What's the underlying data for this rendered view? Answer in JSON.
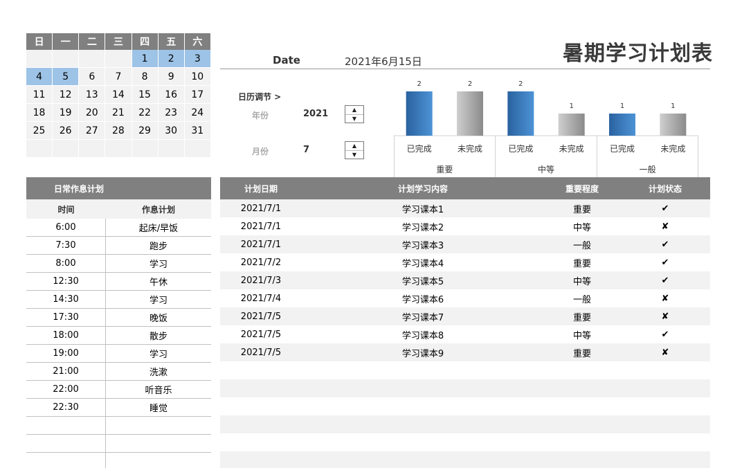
{
  "title": "暑期学习计划表",
  "date": {
    "label": "Date",
    "value": "2021年6月15日"
  },
  "calendar": {
    "weekdays": [
      "日",
      "一",
      "二",
      "三",
      "四",
      "五",
      "六"
    ],
    "rows": [
      [
        "",
        "",
        "",
        "",
        "1",
        "2",
        "3"
      ],
      [
        "4",
        "5",
        "6",
        "7",
        "8",
        "9",
        "10"
      ],
      [
        "11",
        "12",
        "13",
        "14",
        "15",
        "16",
        "17"
      ],
      [
        "18",
        "19",
        "20",
        "21",
        "22",
        "23",
        "24"
      ],
      [
        "25",
        "26",
        "27",
        "28",
        "29",
        "30",
        "31"
      ],
      [
        "",
        "",
        "",
        "",
        "",
        "",
        ""
      ]
    ],
    "highlighted": [
      "1",
      "2",
      "3",
      "4",
      "5"
    ]
  },
  "adjust": {
    "label": "日历调节 >",
    "year_label": "年份",
    "year_value": "2021",
    "month_label": "月份",
    "month_value": "7"
  },
  "chart_data": {
    "type": "bar",
    "groups": [
      "重要",
      "中等",
      "一般"
    ],
    "categories": [
      "已完成",
      "未完成",
      "已完成",
      "未完成",
      "已完成",
      "未完成"
    ],
    "values": [
      2,
      2,
      2,
      1,
      1,
      1
    ],
    "data_labels": [
      "2",
      "2",
      "2",
      "1",
      "1",
      "1"
    ],
    "ylim": [
      0,
      2
    ],
    "colors": {
      "done": "#3a7bbf",
      "undone": "#9a9a9a"
    },
    "grid": false,
    "legend": "none"
  },
  "daily": {
    "title": "日常作息计划",
    "headers": [
      "时间",
      "作息计划"
    ],
    "rows": [
      [
        "6:00",
        "起床/早饭"
      ],
      [
        "7:30",
        "跑步"
      ],
      [
        "8:00",
        "学习"
      ],
      [
        "12:30",
        "午休"
      ],
      [
        "14:30",
        "学习"
      ],
      [
        "17:30",
        "晚饭"
      ],
      [
        "18:00",
        "散步"
      ],
      [
        "19:00",
        "学习"
      ],
      [
        "21:00",
        "洗漱"
      ],
      [
        "22:00",
        "听音乐"
      ],
      [
        "22:30",
        "睡觉"
      ],
      [
        "",
        ""
      ],
      [
        "",
        ""
      ],
      [
        "",
        ""
      ]
    ]
  },
  "plan": {
    "headers": [
      "计划日期",
      "计划学习内容",
      "重要程度",
      "计划状态"
    ],
    "rows": [
      [
        "2021/7/1",
        "学习课本1",
        "重要",
        "✔"
      ],
      [
        "2021/7/1",
        "学习课本2",
        "中等",
        "✘"
      ],
      [
        "2021/7/1",
        "学习课本3",
        "一般",
        "✔"
      ],
      [
        "2021/7/2",
        "学习课本4",
        "重要",
        "✔"
      ],
      [
        "2021/7/3",
        "学习课本5",
        "中等",
        "✔"
      ],
      [
        "2021/7/4",
        "学习课本6",
        "一般",
        "✘"
      ],
      [
        "2021/7/5",
        "学习课本7",
        "重要",
        "✘"
      ],
      [
        "2021/7/5",
        "学习课本8",
        "中等",
        "✔"
      ],
      [
        "2021/7/5",
        "学习课本9",
        "重要",
        "✘"
      ],
      [
        "",
        "",
        "",
        ""
      ],
      [
        "",
        "",
        "",
        ""
      ],
      [
        "",
        "",
        "",
        ""
      ],
      [
        "",
        "",
        "",
        ""
      ],
      [
        "",
        "",
        "",
        ""
      ],
      [
        "",
        "",
        "",
        ""
      ]
    ]
  }
}
